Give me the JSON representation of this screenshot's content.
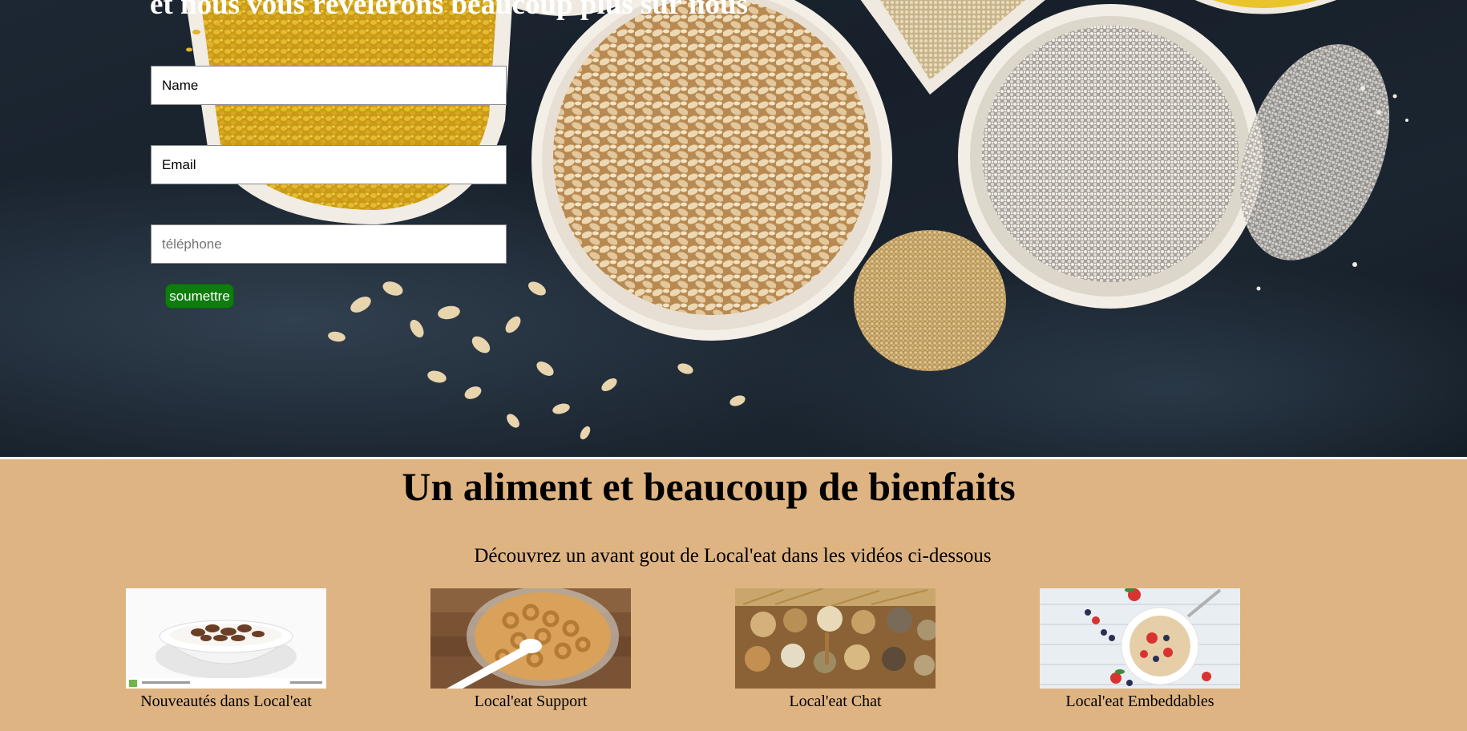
{
  "hero": {
    "heading": "et nous vous révèlerons beaucoup plus sur nous",
    "form": {
      "name_value": "Name",
      "email_value": "Email",
      "phone_placeholder": "téléphone",
      "submit_label": "soumettre"
    }
  },
  "section": {
    "title": "Un aliment et beaucoup de bienfaits",
    "subtitle": "Découvrez un avant gout de Local'eat dans les vidéos ci-dessous",
    "videos": [
      {
        "caption": "Nouveautés dans Local'eat",
        "icon": "cereal-bowl-milk-image"
      },
      {
        "caption": "Local'eat Support",
        "icon": "cheerios-bowl-image"
      },
      {
        "caption": "Local'eat Chat",
        "icon": "grain-spoons-image"
      },
      {
        "caption": "Local'eat Embeddables",
        "icon": "oatmeal-berries-image"
      }
    ]
  },
  "colors": {
    "section_background": "#dfb483",
    "submit_button": "#0e7d0e",
    "hero_background": "#1b2530"
  }
}
